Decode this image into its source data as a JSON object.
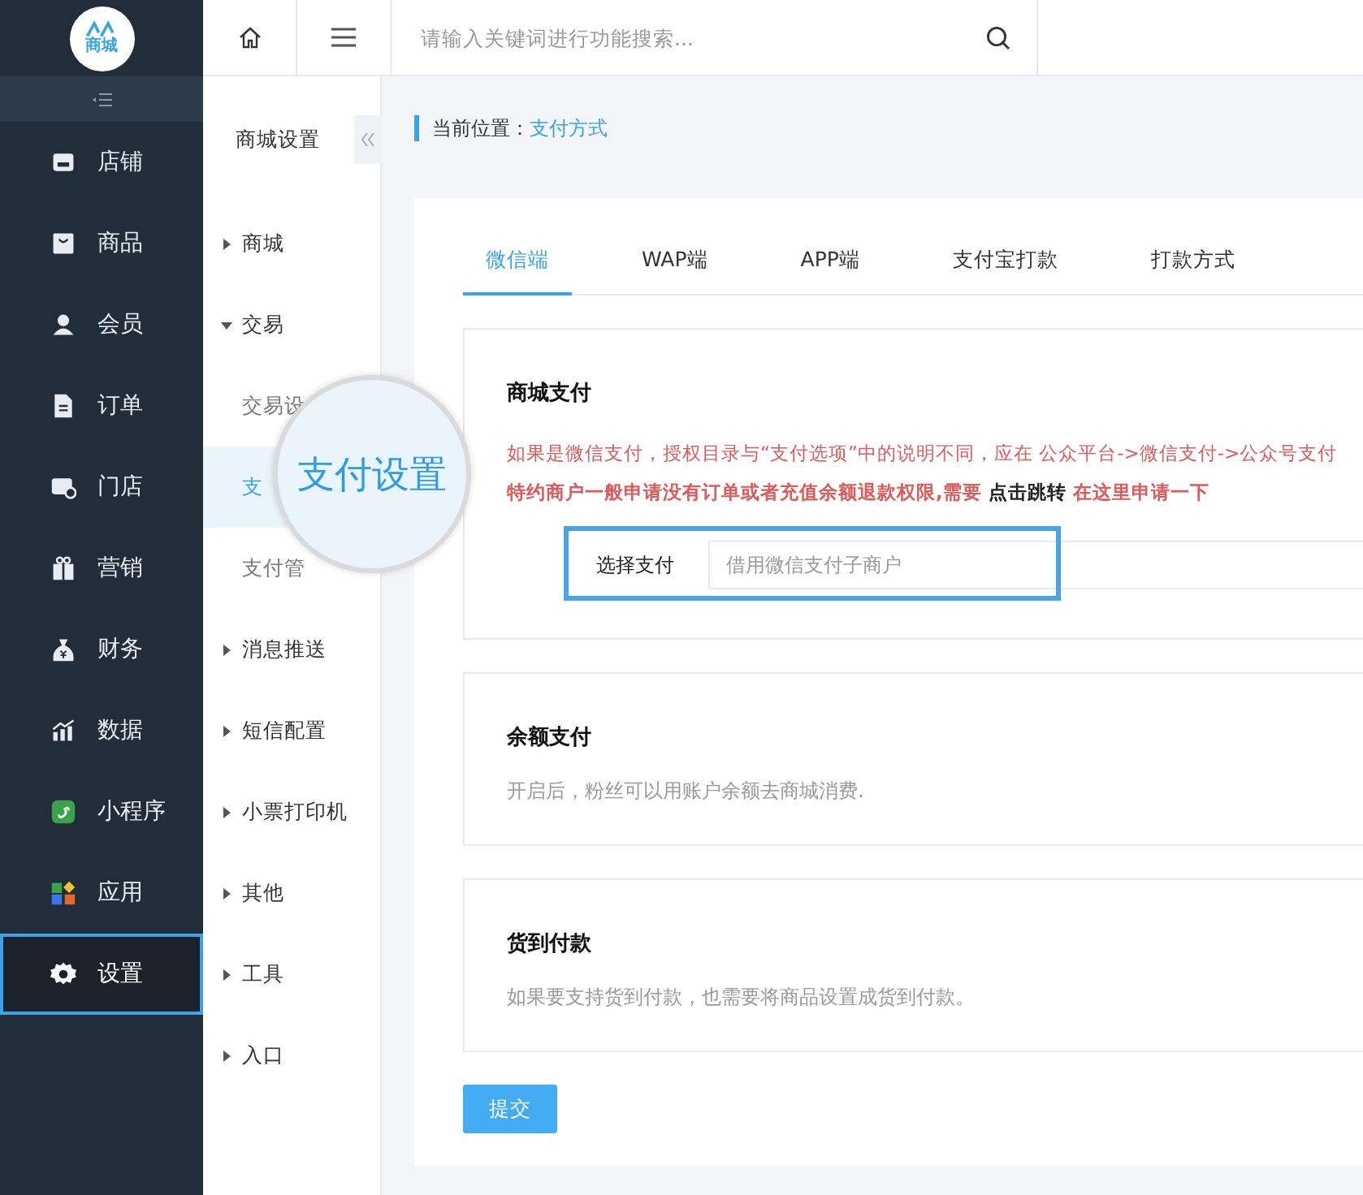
{
  "sidebar": {
    "logo": "商城",
    "items": [
      {
        "label": "店铺",
        "selected": false
      },
      {
        "label": "商品",
        "selected": false
      },
      {
        "label": "会员",
        "selected": false
      },
      {
        "label": "订单",
        "selected": false
      },
      {
        "label": "门店",
        "selected": false
      },
      {
        "label": "营销",
        "selected": false
      },
      {
        "label": "财务",
        "selected": false
      },
      {
        "label": "数据",
        "selected": false
      },
      {
        "label": "小程序",
        "selected": false
      },
      {
        "label": "应用",
        "selected": false
      },
      {
        "label": "设置",
        "selected": true
      }
    ]
  },
  "topbar": {
    "search": {
      "placeholder": "请输入关键词进行功能搜索..."
    }
  },
  "subnav": {
    "title": "商城设置",
    "items": [
      {
        "label": "商城",
        "expanded": false
      },
      {
        "label": "交易",
        "expanded": true,
        "children": [
          {
            "label": "交易设",
            "selected": false
          },
          {
            "label": "支",
            "selected": true
          },
          {
            "label": "支付管",
            "selected": false
          }
        ]
      },
      {
        "label": "消息推送",
        "expanded": false
      },
      {
        "label": "短信配置",
        "expanded": false
      },
      {
        "label": "小票打印机",
        "expanded": false
      },
      {
        "label": "其他",
        "expanded": false
      },
      {
        "label": "工具",
        "expanded": false
      },
      {
        "label": "入口",
        "expanded": false
      }
    ],
    "magnifier": "支付设置"
  },
  "breadcrumb": {
    "label": "当前位置：",
    "current": "支付方式"
  },
  "tabs": [
    {
      "label": "微信端",
      "selected": true
    },
    {
      "label": "WAP端",
      "selected": false
    },
    {
      "label": "APP端",
      "selected": false
    },
    {
      "label": "支付宝打款",
      "selected": false
    },
    {
      "label": "打款方式",
      "selected": false
    }
  ],
  "sections": [
    {
      "kind": "wechat",
      "title": "商城支付",
      "notice": "如果是微信支付，授权目录与“支付选项”中的说明不同，应在 公众平台->微信支付->公众号支付",
      "notice2": [
        {
          "kind": "text",
          "text": "特约商户一般申请没有订单或者充值余额退款权限,需要 "
        },
        {
          "kind": "link",
          "text": "点击跳转"
        },
        {
          "kind": "text",
          "text": " 在这里申请一下"
        }
      ],
      "field": {
        "label": "选择支付",
        "placeholder": "借用微信支付子商户"
      }
    },
    {
      "kind": "plain",
      "title": "余额支付",
      "desc": "开启后，粉丝可以用账户余额去商城消费."
    },
    {
      "kind": "plain",
      "title": "货到付款",
      "desc": "如果要支持货到付款，也需要将商品设置成货到付款。"
    }
  ],
  "submit": "提交"
}
